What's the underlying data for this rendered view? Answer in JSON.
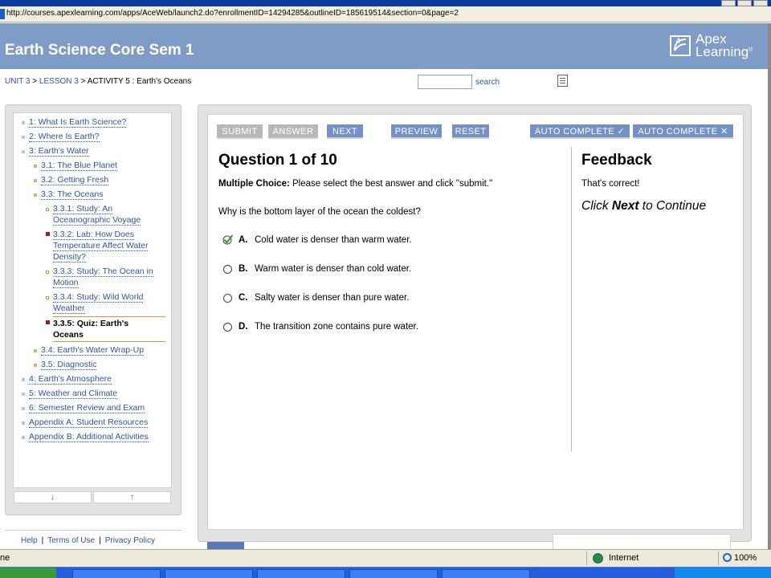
{
  "browser": {
    "url": "http://courses.apexlearning.com/apps/AceWeb/launch2.do?enrollmentID=14294285&outlineID=185619514&section=0&page=2"
  },
  "header": {
    "course_title": "Earth Science Core Sem 1",
    "logo_line1": "Apex",
    "logo_line2": "Learning",
    "logo_reg": "®"
  },
  "breadcrumb": {
    "unit": "UNIT 3",
    "lesson": "LESSON 3",
    "sep": ">",
    "activity": "ACTIVITY 5 : Earth's Oceans"
  },
  "search": {
    "value": "",
    "link": "search"
  },
  "nav": {
    "items": [
      {
        "label": "1: What Is Earth Science?"
      },
      {
        "label": "2: Where Is Earth?"
      },
      {
        "label": "3: Earth's Water"
      },
      {
        "label": "3.1: The Blue Planet"
      },
      {
        "label": "3.2: Getting Fresh"
      },
      {
        "label": "3.3: The Oceans"
      },
      {
        "line1": "3.3.1: Study: An",
        "line2": "Oceanographic Voyage"
      },
      {
        "line1": "3.3.2: Lab: How Does",
        "line2": "Temperature Affect Water",
        "line3": "Density?"
      },
      {
        "line1": "3.3.3: Study: The Ocean in",
        "line2": "Motion"
      },
      {
        "line1": "3.3.4: Study: Wild World",
        "line2": "Weather"
      },
      {
        "line1": "3.3.5: Quiz: Earth's",
        "line2": "Oceans"
      },
      {
        "label": "3.4: Earth's Water Wrap-Up"
      },
      {
        "label": "3.5: Diagnostic"
      },
      {
        "label": "4: Earth's Atmosphere"
      },
      {
        "label": "5: Weather and Climate"
      },
      {
        "label": "6: Semester Review and Exam"
      },
      {
        "label": "Appendix A: Student Resources"
      },
      {
        "label": "Appendix B: Additional Activities"
      }
    ],
    "scroll_down": "↓",
    "scroll_up": "↑"
  },
  "footer": {
    "help": "Help",
    "terms": "Terms of Use",
    "privacy": "Privacy Policy",
    "sep": "|"
  },
  "toolbar": {
    "submit": "SUBMIT",
    "answer": "ANSWER",
    "next": "NEXT",
    "preview": "PREVIEW",
    "reset": "RESET",
    "auto_complete_check": "AUTO COMPLETE ✓",
    "auto_complete_x": "AUTO COMPLETE ✕"
  },
  "question": {
    "title": "Question 1 of 10",
    "type_label": "Multiple Choice:",
    "instructions": "Please select the best answer and click \"submit.\"",
    "prompt": "Why is the bottom layer of the ocean the coldest?",
    "choices": [
      {
        "letter": "A.",
        "text": "Cold water is denser than warm water.",
        "selected": true
      },
      {
        "letter": "B.",
        "text": "Warm water is denser than cold water.",
        "selected": false
      },
      {
        "letter": "C.",
        "text": "Salty water is denser than pure water.",
        "selected": false
      },
      {
        "letter": "D.",
        "text": "The transition zone contains pure water.",
        "selected": false
      }
    ]
  },
  "feedback": {
    "title": "Feedback",
    "text": "That's correct!",
    "next_pre": "Click ",
    "next_bold": "Next",
    "next_post": " to Continue"
  },
  "statusbar": {
    "left_text": "ne",
    "zone": "Internet",
    "zoom": "100%"
  },
  "colors": {
    "header": "#7f9bc8",
    "button_blue": "#7391c8",
    "link": "#2f54a4",
    "active_rule": "#d99a2b"
  }
}
